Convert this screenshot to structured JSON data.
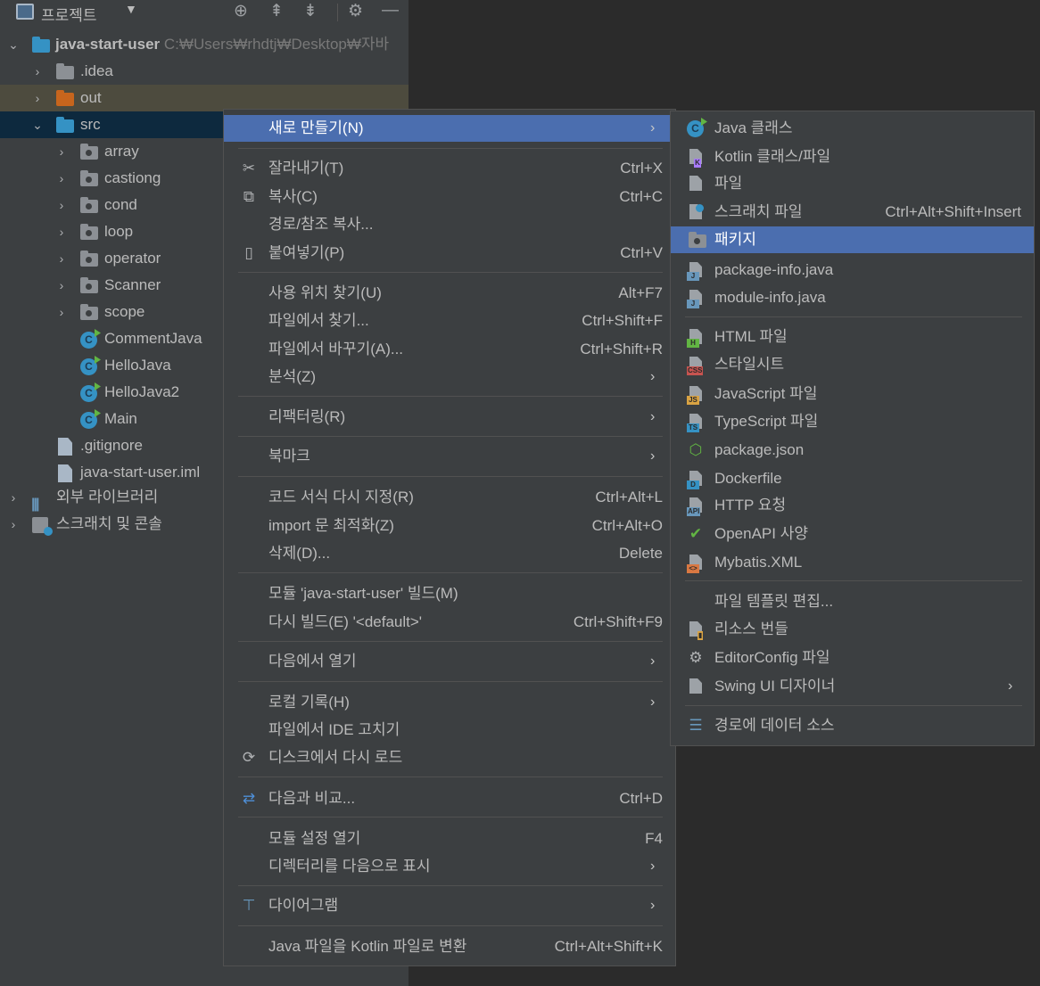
{
  "panel": {
    "title": "프로젝트",
    "tools": [
      "⊕",
      "⇞",
      "⇟",
      "⚙",
      "—"
    ]
  },
  "tree": [
    {
      "label": "java-start-user",
      "path": "C:₩Users₩rhdtj₩Desktop₩자바"
    },
    {
      "label": ".idea"
    },
    {
      "label": "out"
    },
    {
      "label": "src"
    },
    {
      "label": "array"
    },
    {
      "label": "castiong"
    },
    {
      "label": "cond"
    },
    {
      "label": "loop"
    },
    {
      "label": "operator"
    },
    {
      "label": "Scanner"
    },
    {
      "label": "scope"
    },
    {
      "label": "CommentJava"
    },
    {
      "label": "HelloJava"
    },
    {
      "label": "HelloJava2"
    },
    {
      "label": "Main"
    },
    {
      "label": ".gitignore"
    },
    {
      "label": "java-start-user.iml"
    },
    {
      "label": "외부 라이브러리"
    },
    {
      "label": "스크래치 및 콘솔"
    }
  ],
  "context_menu": [
    {
      "label": "새로 만들기(N)",
      "shortcut": ""
    },
    {
      "label": "잘라내기(T)",
      "shortcut": "Ctrl+X"
    },
    {
      "label": "복사(C)",
      "shortcut": "Ctrl+C"
    },
    {
      "label": "경로/참조 복사...",
      "shortcut": ""
    },
    {
      "label": "붙여넣기(P)",
      "shortcut": "Ctrl+V"
    },
    {
      "label": "사용 위치 찾기(U)",
      "shortcut": "Alt+F7"
    },
    {
      "label": "파일에서 찾기...",
      "shortcut": "Ctrl+Shift+F"
    },
    {
      "label": "파일에서 바꾸기(A)...",
      "shortcut": "Ctrl+Shift+R"
    },
    {
      "label": "분석(Z)",
      "shortcut": ""
    },
    {
      "label": "리팩터링(R)",
      "shortcut": ""
    },
    {
      "label": "북마크",
      "shortcut": ""
    },
    {
      "label": "코드 서식 다시 지정(R)",
      "shortcut": "Ctrl+Alt+L"
    },
    {
      "label": "import 문 최적화(Z)",
      "shortcut": "Ctrl+Alt+O"
    },
    {
      "label": "삭제(D)...",
      "shortcut": "Delete"
    },
    {
      "label": "모듈 'java-start-user' 빌드(M)",
      "shortcut": ""
    },
    {
      "label": "다시 빌드(E) '<default>'",
      "shortcut": "Ctrl+Shift+F9"
    },
    {
      "label": "다음에서 열기",
      "shortcut": ""
    },
    {
      "label": "로컬 기록(H)",
      "shortcut": ""
    },
    {
      "label": "파일에서 IDE 고치기",
      "shortcut": ""
    },
    {
      "label": "디스크에서 다시 로드",
      "shortcut": ""
    },
    {
      "label": "다음과 비교...",
      "shortcut": "Ctrl+D"
    },
    {
      "label": "모듈 설정 열기",
      "shortcut": "F4"
    },
    {
      "label": "디렉터리를 다음으로 표시",
      "shortcut": ""
    },
    {
      "label": "다이어그램",
      "shortcut": ""
    },
    {
      "label": "Java 파일을 Kotlin 파일로 변환",
      "shortcut": "Ctrl+Alt+Shift+K"
    }
  ],
  "submenu": [
    {
      "label": "Java 클래스",
      "shortcut": ""
    },
    {
      "label": "Kotlin 클래스/파일",
      "shortcut": ""
    },
    {
      "label": "파일",
      "shortcut": ""
    },
    {
      "label": "스크래치 파일",
      "shortcut": "Ctrl+Alt+Shift+Insert"
    },
    {
      "label": "패키지",
      "shortcut": ""
    },
    {
      "label": "package-info.java",
      "shortcut": ""
    },
    {
      "label": "module-info.java",
      "shortcut": ""
    },
    {
      "label": "HTML 파일",
      "shortcut": ""
    },
    {
      "label": "스타일시트",
      "shortcut": ""
    },
    {
      "label": "JavaScript 파일",
      "shortcut": ""
    },
    {
      "label": "TypeScript 파일",
      "shortcut": ""
    },
    {
      "label": "package.json",
      "shortcut": ""
    },
    {
      "label": "Dockerfile",
      "shortcut": ""
    },
    {
      "label": "HTTP 요청",
      "shortcut": ""
    },
    {
      "label": "OpenAPI 사양",
      "shortcut": ""
    },
    {
      "label": "Mybatis.XML",
      "shortcut": ""
    },
    {
      "label": "파일 템플릿 편집...",
      "shortcut": ""
    },
    {
      "label": "리소스 번들",
      "shortcut": ""
    },
    {
      "label": "EditorConfig 파일",
      "shortcut": ""
    },
    {
      "label": "Swing UI 디자이너",
      "shortcut": ""
    },
    {
      "label": "경로에 데이터 소스",
      "shortcut": ""
    }
  ],
  "colors": {
    "panel_bg": "#3c3f41",
    "editor_bg": "#2b2b2b",
    "highlight": "#4b6eaf",
    "selection": "#0d293e"
  }
}
